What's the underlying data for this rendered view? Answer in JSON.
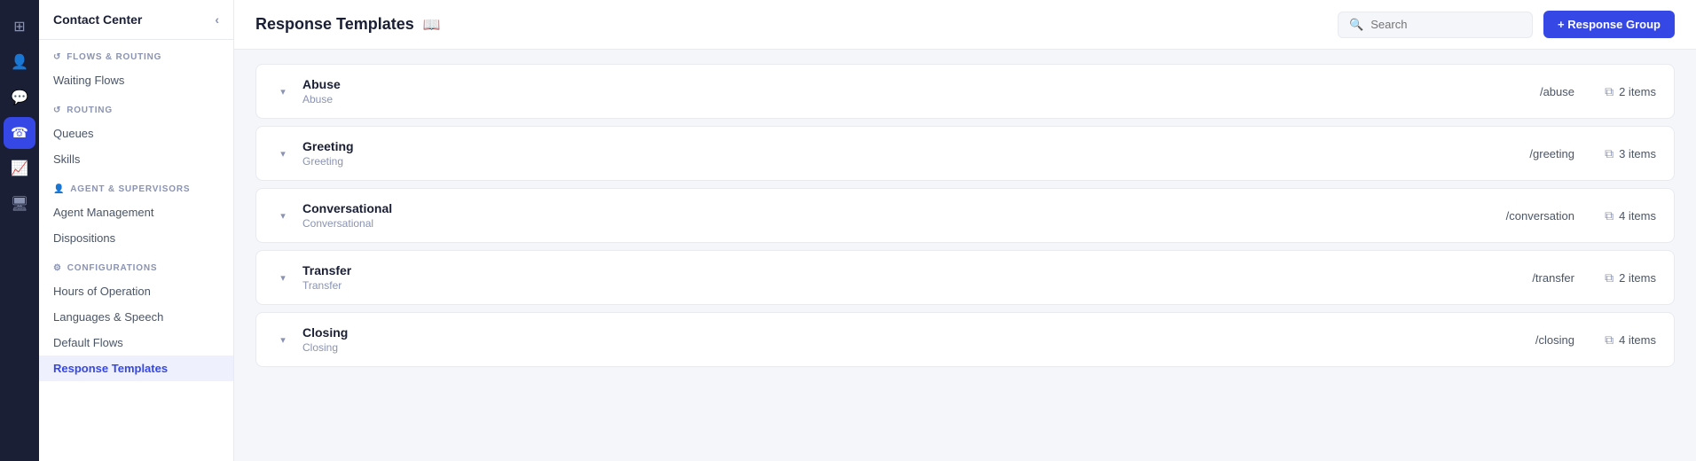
{
  "app": {
    "title": "Contact Center"
  },
  "page": {
    "title": "Response Templates",
    "title_icon": "📖"
  },
  "header": {
    "search_placeholder": "Search",
    "add_button_label": "+ Response Group"
  },
  "sidebar": {
    "header": "Contact Center",
    "sections": [
      {
        "id": "flows-routing",
        "label": "FLOWS & ROUTING",
        "items": [
          {
            "id": "waiting-flows",
            "label": "Waiting Flows",
            "active": false
          }
        ]
      },
      {
        "id": "routing",
        "label": "ROUTING",
        "items": [
          {
            "id": "queues",
            "label": "Queues",
            "active": false
          },
          {
            "id": "skills",
            "label": "Skills",
            "active": false
          }
        ]
      },
      {
        "id": "agent-supervisors",
        "label": "AGENT & SUPERVISORS",
        "items": [
          {
            "id": "agent-management",
            "label": "Agent Management",
            "active": false
          },
          {
            "id": "dispositions",
            "label": "Dispositions",
            "active": false
          }
        ]
      },
      {
        "id": "configurations",
        "label": "CONFIGURATIONS",
        "items": [
          {
            "id": "hours-of-operation",
            "label": "Hours of Operation",
            "active": false
          },
          {
            "id": "languages-speech",
            "label": "Languages & Speech",
            "active": false
          },
          {
            "id": "default-flows",
            "label": "Default Flows",
            "active": false
          },
          {
            "id": "response-templates",
            "label": "Response Templates",
            "active": true
          }
        ]
      }
    ]
  },
  "icon_rail": {
    "items": [
      {
        "id": "home",
        "icon": "⊞",
        "active": false
      },
      {
        "id": "contacts",
        "icon": "👤",
        "active": false
      },
      {
        "id": "chat",
        "icon": "💬",
        "active": false
      },
      {
        "id": "contact-center",
        "icon": "☎",
        "active": true
      },
      {
        "id": "analytics",
        "icon": "📈",
        "active": false
      },
      {
        "id": "monitor",
        "icon": "🖥",
        "active": false
      }
    ]
  },
  "templates": [
    {
      "id": "abuse",
      "name": "Abuse",
      "subtitle": "Abuse",
      "path": "/abuse",
      "items_count": "2 items"
    },
    {
      "id": "greeting",
      "name": "Greeting",
      "subtitle": "Greeting",
      "path": "/greeting",
      "items_count": "3 items"
    },
    {
      "id": "conversational",
      "name": "Conversational",
      "subtitle": "Conversational",
      "path": "/conversation",
      "items_count": "4 items"
    },
    {
      "id": "transfer",
      "name": "Transfer",
      "subtitle": "Transfer",
      "path": "/transfer",
      "items_count": "2 items"
    },
    {
      "id": "closing",
      "name": "Closing",
      "subtitle": "Closing",
      "path": "/closing",
      "items_count": "4 items"
    }
  ]
}
